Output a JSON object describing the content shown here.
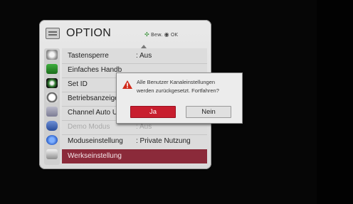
{
  "menu": {
    "title": "OPTION",
    "hint_move_icon": "dpad-icon",
    "hint_move": "Bew.",
    "hint_ok_icon": "ok-circle-icon",
    "hint_ok": "OK",
    "rows": [
      {
        "label": "Tastensperre",
        "value": ": Aus",
        "disabled": false
      },
      {
        "label": "Einfaches Handb",
        "value": "",
        "disabled": false
      },
      {
        "label": "Set ID",
        "value": "",
        "disabled": false
      },
      {
        "label": "Betriebsanzeige",
        "value": "",
        "disabled": false
      },
      {
        "label": "Channel Auto U",
        "value": "",
        "disabled": false
      },
      {
        "label": "Demo Modus",
        "value": ": Aus",
        "disabled": true
      },
      {
        "label": "Moduseinstellung",
        "value": ": Private Nutzung",
        "disabled": false
      },
      {
        "label": "Werkseinstellung",
        "value": "",
        "disabled": false,
        "selected": true
      }
    ],
    "side_icons": [
      "picture-icon",
      "screen-icon",
      "setup-icon",
      "clock-icon",
      "option-icon",
      "lock-icon",
      "bluetooth-icon",
      "input-icon"
    ]
  },
  "dialog": {
    "message_line1": "Alle Benutzer Kanaleinstellungen",
    "message_line2": "werden zurückgesetzt. Fortfahren?",
    "yes": "Ja",
    "no": "Nein",
    "accent": "#c81e2e"
  }
}
